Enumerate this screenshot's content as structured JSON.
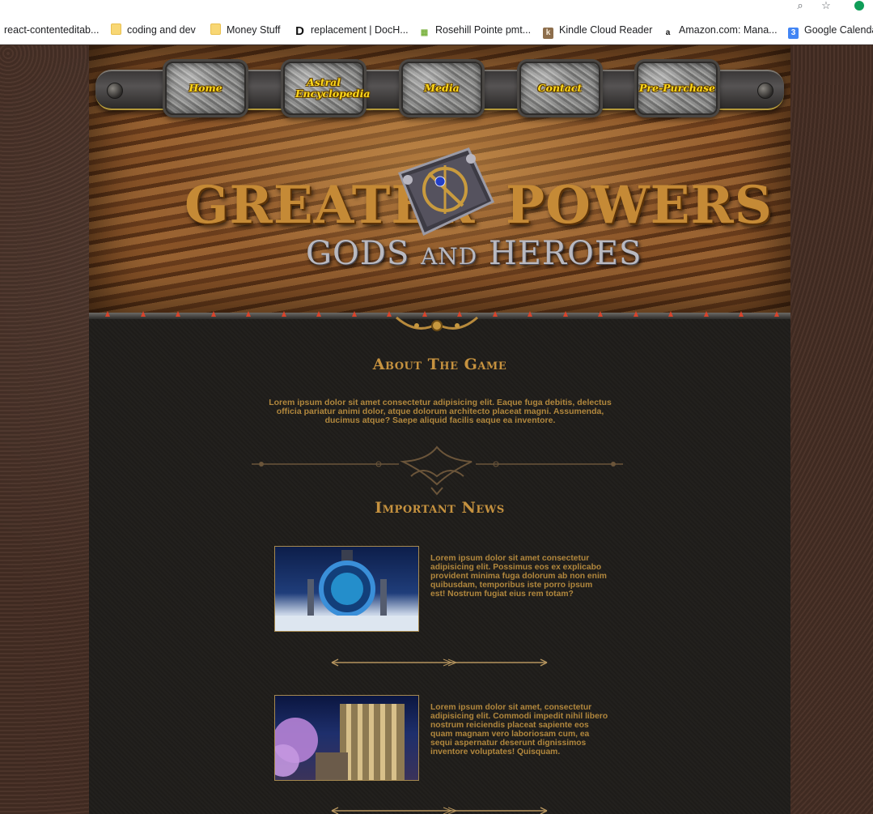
{
  "browser": {
    "bookmarks": [
      {
        "label": "react-contenteditab...",
        "icon": "none"
      },
      {
        "label": "coding and dev",
        "icon": "folder-icon"
      },
      {
        "label": "Money Stuff",
        "icon": "folder-icon"
      },
      {
        "label": "replacement | DocH...",
        "icon": "d-logo-icon"
      },
      {
        "label": "Rosehill Pointe pmt...",
        "icon": "building-icon"
      },
      {
        "label": "Kindle Cloud Reader",
        "icon": "kindle-icon"
      },
      {
        "label": "Amazon.com: Mana...",
        "icon": "amazon-icon"
      },
      {
        "label": "Google Calenda",
        "icon": "calendar-icon"
      }
    ],
    "icon_glyphs": {
      "d": "D",
      "k": "k",
      "amazon": "a",
      "calendar": "3",
      "zoom": "⌕",
      "star": "☆",
      "building": "▦"
    }
  },
  "nav": {
    "items": [
      "Home",
      "Astral Encyclopedia",
      "Media",
      "Contact",
      "Pre-Purchase"
    ]
  },
  "logo": {
    "line1_left": "GREATER",
    "line1_right": "POWERS",
    "line2_a": "GODS",
    "line2_b": "AND",
    "line2_c": "HEROES"
  },
  "about": {
    "title": "About The Game",
    "text": "Lorem ipsum dolor sit amet consectetur adipisicing elit. Eaque fuga debitis, delectus officia pariatur animi dolor, atque dolorum architecto placeat magni. Assumenda, ducimus atque? Saepe aliquid facilis eaque ea inventore."
  },
  "news": {
    "title": "Important News",
    "items": [
      {
        "text": "Lorem ipsum dolor sit amet consectetur adipisicing elit. Possimus eos ex explicabo provident minima fuga dolorum ab non enim quibusdam, temporibus iste porro ipsum est! Nostrum fugiat eius rem totam?",
        "image": "stargate-portal-image"
      },
      {
        "text": "Lorem ipsum dolor sit amet, consectetur adipisicing elit. Commodi impedit nihil libero nostrum reiciendis placeat sapiente eos quam magnam vero laboriosam cum, ea sequi aspernatur deserunt dignissimos inventore voluptates! Quisquam.",
        "image": "golden-temple-image"
      }
    ]
  },
  "colors": {
    "accent_gold": "#c6923f",
    "body_text": "#b1873d",
    "nav_text": "#ffd81a",
    "background_panel": "#1f1d1a"
  }
}
